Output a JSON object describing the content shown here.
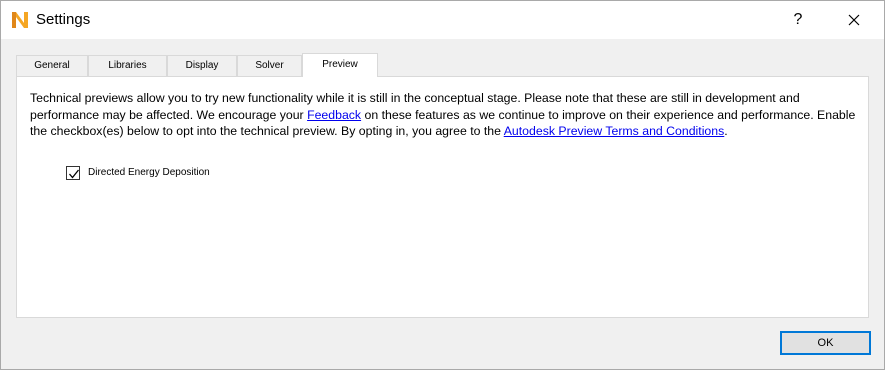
{
  "window": {
    "title": "Settings",
    "help_label": "?"
  },
  "tabs": [
    {
      "label": "General"
    },
    {
      "label": "Libraries"
    },
    {
      "label": "Display"
    },
    {
      "label": "Solver"
    },
    {
      "label": "Preview"
    }
  ],
  "active_tab": "Preview",
  "preview": {
    "text_part1": "Technical previews allow you to try new functionality while it is still in the conceptual stage. Please note that these are still in development and performance may be affected. We encourage your ",
    "feedback_link": "Feedback",
    "text_part2": " on these features as we continue to improve on their experience and performance. Enable the checkbox(es) below to opt into the technical preview. By opting in, you agree to the ",
    "terms_link": "Autodesk Preview Terms and Conditions",
    "text_part3": ".",
    "option_label": "Directed Energy Deposition",
    "option_checked": true
  },
  "footer": {
    "ok_label": "OK"
  },
  "colors": {
    "accent": "#0078d7",
    "link": "#0000ee",
    "icon_orange": "#f5a623"
  }
}
